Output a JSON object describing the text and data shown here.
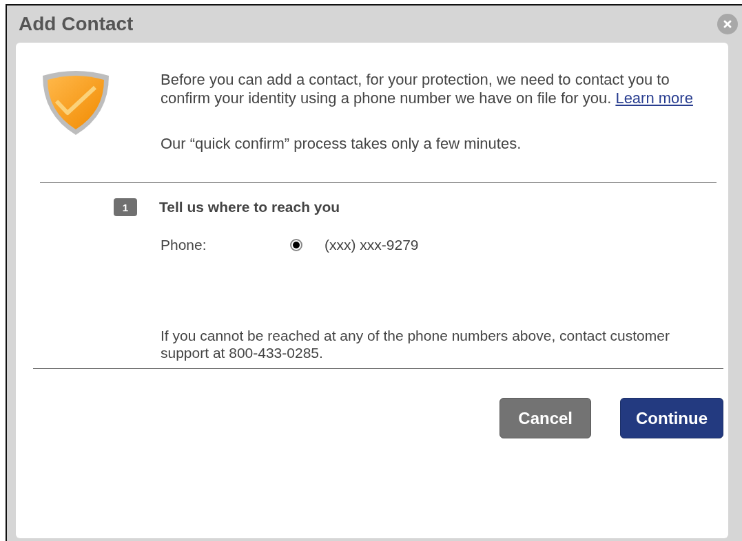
{
  "dialog": {
    "title": "Add Contact"
  },
  "intro": {
    "text": "Before you can add a contact, for your protection, we need to contact you to confirm your identity using a phone number we have on file for you.",
    "link": "Learn more"
  },
  "note": "Our “quick confirm” process takes only a few minutes.",
  "step": {
    "number": "1",
    "heading": "Tell us where to reach you",
    "label": "Phone:",
    "options": [
      {
        "value": "(xxx) xxx-9279",
        "selected": true
      }
    ]
  },
  "notice": "If you cannot be reached at any of the phone numbers above, contact customer support at 800-433-0285.",
  "buttons": [
    {
      "label": "Cancel",
      "kind": "secondary"
    },
    {
      "label": "Continue",
      "kind": "primary"
    }
  ]
}
